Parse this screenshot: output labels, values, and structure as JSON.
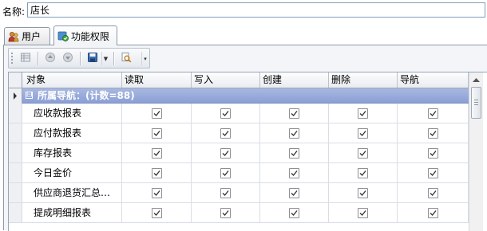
{
  "form": {
    "name_label": "名称:",
    "name_value": "店长"
  },
  "tabs": [
    {
      "label": "用户",
      "icon": "users-icon",
      "active": false
    },
    {
      "label": "功能权限",
      "icon": "shield-check-icon",
      "active": true
    }
  ],
  "toolbar": {
    "buttons": [
      "grid-view-icon",
      "arrow-up-circle-icon",
      "arrow-down-circle-icon",
      "save-disk-icon",
      "search-doc-icon"
    ]
  },
  "grid": {
    "columns": [
      "对象",
      "读取",
      "写入",
      "创建",
      "删除",
      "导航"
    ],
    "group": {
      "label": "所属导航：(计数=88)",
      "toggle": "⊟"
    },
    "rows": [
      {
        "name": "应收款报表",
        "read": true,
        "write": true,
        "create": true,
        "delete": true,
        "nav": true
      },
      {
        "name": "应付款报表",
        "read": true,
        "write": true,
        "create": true,
        "delete": true,
        "nav": true
      },
      {
        "name": "库存报表",
        "read": true,
        "write": true,
        "create": true,
        "delete": true,
        "nav": true
      },
      {
        "name": "今日金价",
        "read": true,
        "write": true,
        "create": true,
        "delete": true,
        "nav": true
      },
      {
        "name": "供应商退货汇总…",
        "read": true,
        "write": true,
        "create": true,
        "delete": true,
        "nav": true
      },
      {
        "name": "提成明细报表",
        "read": true,
        "write": true,
        "create": true,
        "delete": true,
        "nav": true
      }
    ]
  },
  "colors": {
    "group_bg": "#8a9fd6",
    "border": "#9aa6b6"
  }
}
